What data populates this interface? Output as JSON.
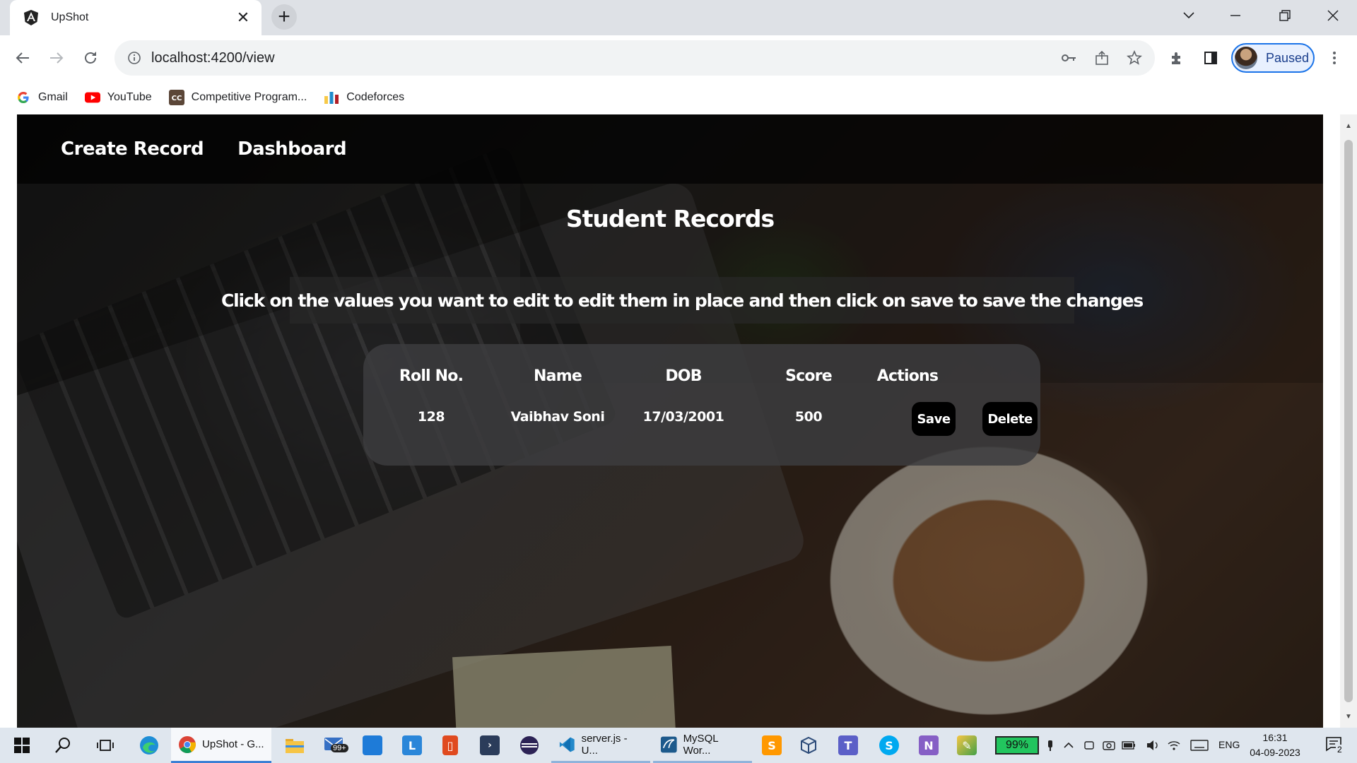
{
  "browser": {
    "tab": {
      "title": "UpShot",
      "favicon": "angular-icon"
    },
    "window_controls": [
      "chevron-down-icon",
      "minimize-icon",
      "restore-icon",
      "close-icon"
    ],
    "omnibox": {
      "url": "localhost:4200/view"
    },
    "profile": {
      "label": "Paused"
    },
    "bookmarks": [
      {
        "label": "Gmail",
        "icon": "google-icon"
      },
      {
        "label": "YouTube",
        "icon": "youtube-icon"
      },
      {
        "label": "Competitive Program...",
        "icon": "codechef-icon"
      },
      {
        "label": "Codeforces",
        "icon": "codeforces-icon"
      }
    ]
  },
  "app": {
    "nav": {
      "create_record": "Create Record",
      "dashboard": "Dashboard"
    },
    "title": "Student Records",
    "hint": "Click on the values you want to edit to edit them in place and then click on save to save the changes",
    "table": {
      "headers": [
        "Roll No.",
        "Name",
        "DOB",
        "Score",
        "Actions"
      ],
      "rows": [
        {
          "roll": "128",
          "name": "Vaibhav Soni",
          "dob": "17/03/2001",
          "score": "500"
        }
      ],
      "actions": {
        "save": "Save",
        "delete": "Delete"
      }
    }
  },
  "taskbar": {
    "apps": [
      {
        "label": "UpShot - G...",
        "icon": "chrome-icon"
      },
      {
        "label": "server.js - U...",
        "icon": "vscode-icon"
      },
      {
        "label": "MySQL Wor...",
        "icon": "mysql-workbench-icon"
      }
    ],
    "mail_badge": "99+",
    "battery": "99%",
    "language": "ENG",
    "time": "16:31",
    "date": "04-09-2023",
    "notification_count": "2"
  }
}
